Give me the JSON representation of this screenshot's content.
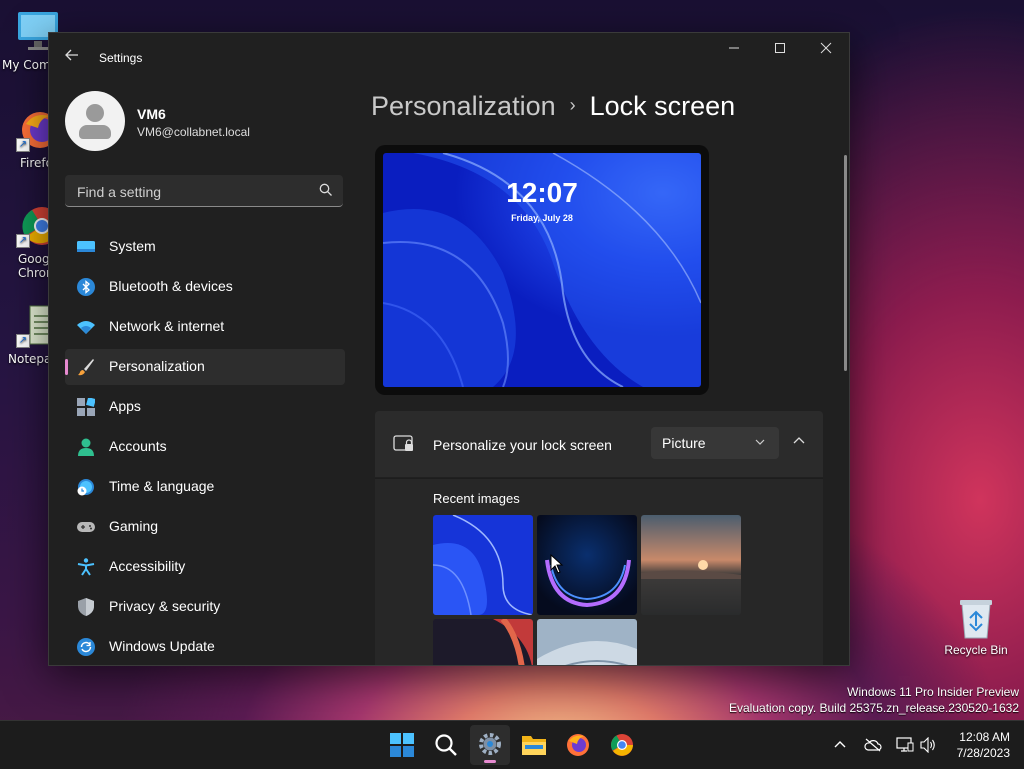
{
  "desktop": {
    "icons": [
      {
        "label": "My Com"
      },
      {
        "label": "Firefo"
      },
      {
        "label": "Goog\nChron"
      },
      {
        "label": "Notepa"
      }
    ],
    "recycle_bin": "Recycle Bin",
    "watermark_line1": "Windows 11 Pro Insider Preview",
    "watermark_line2": "Evaluation copy. Build 25375.zn_release.230520-1632"
  },
  "window": {
    "title": "Settings",
    "minimize": "—",
    "maximize": "☐",
    "close": "✕"
  },
  "user": {
    "name": "VM6",
    "email": "VM6@collabnet.local"
  },
  "search": {
    "placeholder": "Find a setting"
  },
  "nav": {
    "items": [
      {
        "label": "System",
        "icon": "system-icon"
      },
      {
        "label": "Bluetooth & devices",
        "icon": "bluetooth-icon"
      },
      {
        "label": "Network & internet",
        "icon": "wifi-icon"
      },
      {
        "label": "Personalization",
        "icon": "brush-icon",
        "active": true
      },
      {
        "label": "Apps",
        "icon": "apps-icon"
      },
      {
        "label": "Accounts",
        "icon": "accounts-icon"
      },
      {
        "label": "Time & language",
        "icon": "globe-clock-icon"
      },
      {
        "label": "Gaming",
        "icon": "gamepad-icon"
      },
      {
        "label": "Accessibility",
        "icon": "accessibility-icon"
      },
      {
        "label": "Privacy & security",
        "icon": "shield-icon"
      },
      {
        "label": "Windows Update",
        "icon": "update-icon"
      }
    ]
  },
  "breadcrumb": {
    "parent": "Personalization",
    "separator": "›",
    "current": "Lock screen"
  },
  "preview": {
    "time": "12:07",
    "date": "Friday, July 28"
  },
  "lock_card": {
    "label": "Personalize your lock screen",
    "dropdown_value": "Picture",
    "recent_label": "Recent images"
  },
  "taskbar": {
    "apps": [
      "start-icon",
      "search-icon",
      "settings-icon",
      "file-explorer-icon",
      "firefox-icon",
      "chrome-icon"
    ]
  },
  "clock": {
    "time": "12:08 AM",
    "date": "7/28/2023"
  },
  "colors": {
    "accent": "#e68ad0",
    "window_bg": "#202020",
    "card_bg": "#2b2b2b"
  }
}
